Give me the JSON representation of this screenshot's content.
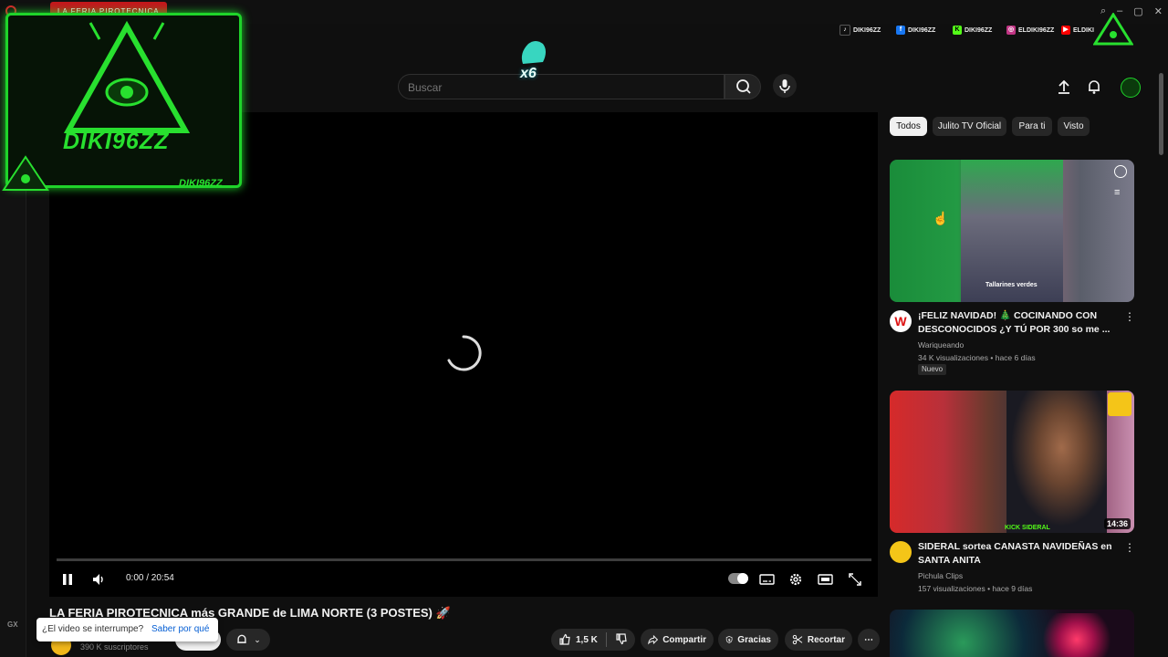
{
  "browser": {
    "tab_title": "LA FERIA PIROTECNICA",
    "gx_label": "GX"
  },
  "overlay": {
    "name": "DIKI96ZZ",
    "tag": "DIKI96ZZ",
    "counter": "x6"
  },
  "socials": [
    {
      "icon": "tiktok-icon",
      "label": "DIKI96ZZ",
      "color": "#111111"
    },
    {
      "icon": "facebook-icon",
      "label": "DIKI96ZZ",
      "color": "#1877f2"
    },
    {
      "icon": "kick-icon",
      "label": "DIKI96ZZ",
      "color": "#53fc18"
    },
    {
      "icon": "instagram-icon",
      "label": "ELDIKI96ZZ",
      "color": "#c13584"
    },
    {
      "icon": "youtube-icon",
      "label": "ELDIKI",
      "color": "#ff0000"
    }
  ],
  "header": {
    "search_placeholder": "Buscar"
  },
  "player": {
    "time": "0:00 / 20:54"
  },
  "video": {
    "title": "LA FERIA PIROTECNICA más GRANDE de LIMA NORTE (3 POSTES) 🚀",
    "subscribers": "390 K suscriptores",
    "toast_question": "¿El video se interrumpe?",
    "toast_link": "Saber por qué",
    "likes": "1,5 K",
    "share": "Compartir",
    "thanks": "Gracias",
    "clip": "Recortar"
  },
  "chips": [
    "Todos",
    "Julito TV Oficial",
    "Para ti",
    "Visto"
  ],
  "recommendations": [
    {
      "title": "¡FELIZ NAVIDAD! 🎄 COCINANDO CON DESCONOCIDOS ¿Y TÚ POR 300 so me ...",
      "channel": "Wariqueando",
      "meta": "34 K visualizaciones • hace 6 días",
      "badge": "Nuevo",
      "thumb_caption": "Tallarines verdes"
    },
    {
      "title": "SIDERAL sortea CANASTA NAVIDEÑAS en SANTA ANITA",
      "channel": "Pichula Clips",
      "meta": "157 visualizaciones • hace 9 días",
      "duration": "14:36",
      "thumb_caption": "KICK SIDERAL"
    }
  ],
  "colors": {
    "accent_green": "#1fd42a",
    "yt_background": "#0f0f0f",
    "link_blue": "#065fd4"
  }
}
